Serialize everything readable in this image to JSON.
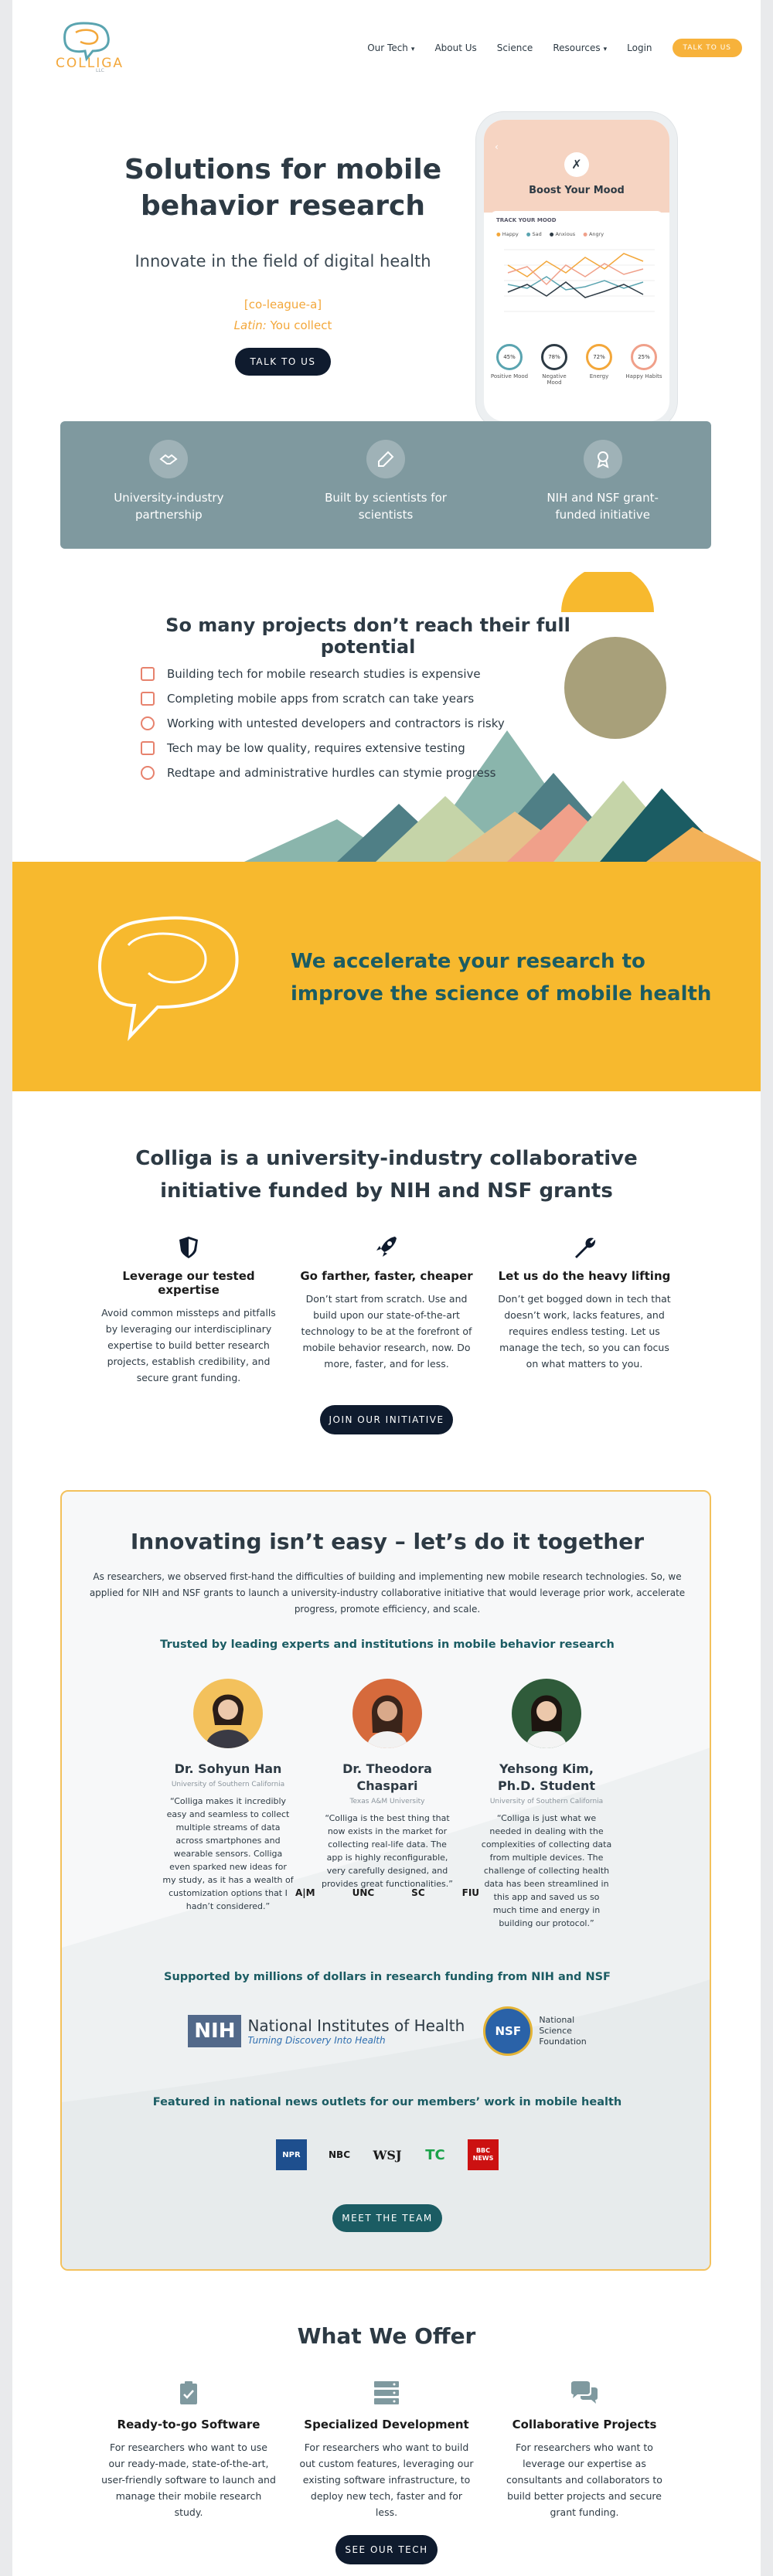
{
  "nav": {
    "logo_text": "COLLIGA",
    "logo_sub": "LLC",
    "links": [
      "Our Tech",
      "About Us",
      "Science",
      "Resources",
      "Login"
    ],
    "cta": "TALK TO US"
  },
  "hero": {
    "title": "Solutions for mobile behavior research",
    "subtitle": "Innovate in the field of digital health",
    "pronunciation": "[co-league-a]",
    "latin_label": "Latin:",
    "latin_text": "You collect",
    "button": "TALK TO US"
  },
  "phone": {
    "header": "Boost Your Mood",
    "track_label": "TRACK YOUR MOOD",
    "legend": [
      "Happy",
      "Sad",
      "Anxious",
      "Angry"
    ],
    "stats": [
      {
        "value": "45%",
        "label": "Positive Mood"
      },
      {
        "value": "78%",
        "label": "Negative Mood"
      },
      {
        "value": "72%",
        "label": "Energy"
      },
      {
        "value": "25%",
        "label": "Happy Habits"
      }
    ]
  },
  "band": {
    "items": [
      {
        "label": "University-industry partnership",
        "icon": "handshake-icon"
      },
      {
        "label": "Built by scientists for scientists",
        "icon": "flask-icon"
      },
      {
        "label": "NIH and NSF grant-funded initiative",
        "icon": "award-icon"
      }
    ]
  },
  "problems": {
    "title": "So many projects don’t reach their full potential",
    "items": [
      "Building tech for mobile research studies is expensive",
      "Completing mobile apps from scratch can take years",
      "Working with untested developers and contractors is risky",
      "Tech may be low quality, requires extensive testing",
      "Redtape and administrative hurdles can stymie progress"
    ]
  },
  "accelerate": {
    "line1": "We accelerate your research to",
    "line2": "improve the science of mobile health"
  },
  "collab": {
    "title": "Colliga is a university-industry collaborative initiative funded by NIH and NSF grants",
    "cols": [
      {
        "icon": "shield-icon",
        "heading": "Leverage our tested expertise",
        "text": "Avoid common missteps and pitfalls by leveraging our interdisciplinary expertise to build better research projects, establish credibility, and secure grant funding."
      },
      {
        "icon": "rocket-icon",
        "heading": "Go farther, faster, cheaper",
        "text": "Don’t start from scratch. Use and build upon our state-of-the-art technology to be at the forefront of mobile behavior research, now. Do more, faster, and for less."
      },
      {
        "icon": "wrench-icon",
        "heading": "Let us do the heavy lifting",
        "text": "Don’t get bogged down in tech that doesn’t work, lacks features, and requires endless testing. Let us manage the tech, so you can focus on what matters to you."
      }
    ],
    "button": "JOIN OUR INITIATIVE"
  },
  "together": {
    "title": "Innovating isn’t easy – let’s do it together",
    "intro": "As researchers, we observed first-hand the difficulties of building and implementing new mobile research technologies. So, we applied for NIH and NSF grants to launch a university-industry collaborative initiative that would leverage prior work, accelerate progress, promote efficiency, and scale.",
    "trusted": "Trusted by leading experts and institutions in mobile behavior research",
    "people": [
      {
        "name": "Dr. Sohyun Han",
        "affiliation": "University of Southern California",
        "quote": "“Colliga makes it incredibly easy and seamless to collect multiple streams of data across smartphones and wearable sensors. Colliga even sparked new ideas for my study, as it has a wealth of customization options that I hadn’t considered.”"
      },
      {
        "name": "Dr. Theodora Chaspari",
        "affiliation": "Texas A&M University",
        "quote": "“Colliga is the best thing that now exists in the market for collecting real-life data. The app is highly reconfigurable, very carefully designed, and provides great functionalities.”"
      },
      {
        "name": "Yehsong Kim, Ph.D. Student",
        "affiliation": "University of Southern California",
        "quote": "“Colliga is just what we needed in dealing with the complexities of collecting data from multiple devices. The challenge of collecting health data has been streamlined in this app and saved us so much time and energy in building our protocol.”"
      }
    ],
    "universities": [
      "A|M",
      "UNC",
      "SC",
      "FIU"
    ],
    "supported": "Supported by millions of dollars in research funding from NIH and NSF",
    "nih": {
      "mark": "NIH",
      "name": "National Institutes of Health",
      "tagline": "Turning Discovery Into Health"
    },
    "nsf": {
      "mark": "NSF",
      "name1": "National",
      "name2": "Science",
      "name3": "Foundation"
    },
    "featured": "Featured in national news outlets for our members’ work in mobile health",
    "news": [
      "NPR",
      "NBC",
      "WSJ",
      "TC",
      "BBC NEWS"
    ],
    "button": "MEET THE TEAM"
  },
  "offer": {
    "title": "What We Offer",
    "cols": [
      {
        "icon": "clipboard-icon",
        "heading": "Ready-to-go Software",
        "text": "For researchers who want to use our ready-made, state-of-the-art, user-friendly software to launch and manage their mobile research study."
      },
      {
        "icon": "server-icon",
        "heading": "Specialized Development",
        "text": "For researchers who want to build out custom features, leveraging our existing software infrastructure, to deploy new tech, faster and for less."
      },
      {
        "icon": "chat-icon",
        "heading": "Collaborative Projects",
        "text": "For researchers who want to leverage our expertise as consultants and collaborators to build better projects and secure grant funding."
      }
    ],
    "button": "SEE OUR TECH"
  },
  "colors": {
    "accent_orange": "#f7b23b",
    "navy": "#0f1b2e",
    "teal": "#1b5c63",
    "slate": "#7f999f",
    "yellow": "#f7b92e"
  }
}
